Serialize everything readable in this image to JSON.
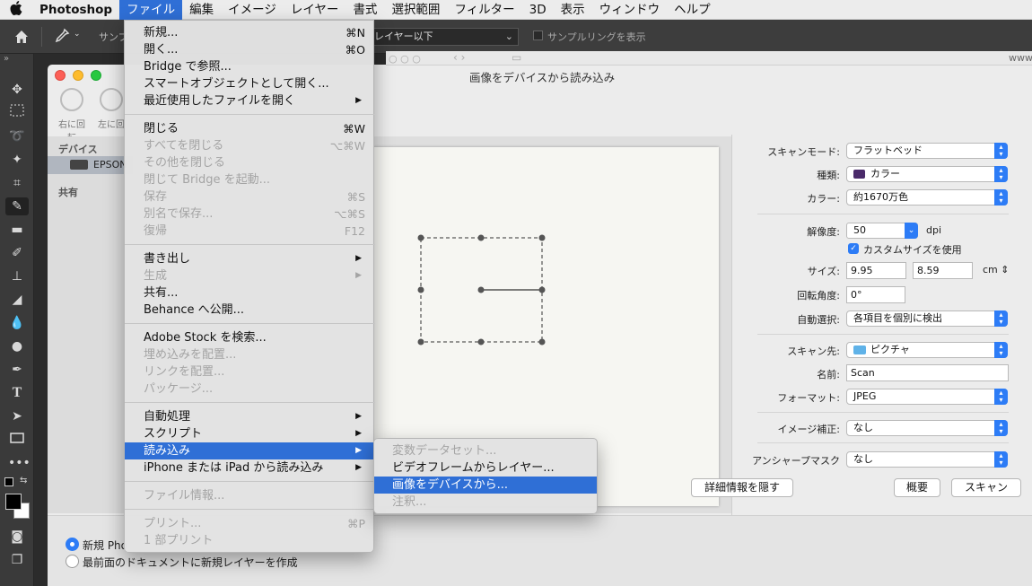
{
  "menubar": {
    "apple": "",
    "app_name": "Photoshop",
    "items": [
      "ファイル",
      "編集",
      "イメージ",
      "レイヤー",
      "書式",
      "選択範囲",
      "フィルター",
      "3D",
      "表示",
      "ウィンドウ",
      "ヘルプ"
    ]
  },
  "optionsbar": {
    "sample_label": "サンプ",
    "sample_select": "レイヤー以下",
    "checkbox_label": "サンプルリングを表示"
  },
  "file_menu": {
    "groups": [
      [
        {
          "label": "新規...",
          "shortcut": "⌘N",
          "disabled": false
        },
        {
          "label": "開く...",
          "shortcut": "⌘O",
          "disabled": false
        },
        {
          "label": "Bridge で参照...",
          "shortcut": "",
          "disabled": false
        },
        {
          "label": "スマートオブジェクトとして開く...",
          "shortcut": "",
          "disabled": false
        },
        {
          "label": "最近使用したファイルを開く",
          "shortcut": "",
          "submenu": true,
          "disabled": false
        }
      ],
      [
        {
          "label": "閉じる",
          "shortcut": "⌘W",
          "disabled": false
        },
        {
          "label": "すべてを閉じる",
          "shortcut": "⌥⌘W",
          "disabled": true
        },
        {
          "label": "その他を閉じる",
          "shortcut": "",
          "disabled": true
        },
        {
          "label": "閉じて Bridge を起動...",
          "shortcut": "",
          "disabled": true
        },
        {
          "label": "保存",
          "shortcut": "⌘S",
          "disabled": true
        },
        {
          "label": "別名で保存...",
          "shortcut": "⌥⌘S",
          "disabled": true
        },
        {
          "label": "復帰",
          "shortcut": "F12",
          "disabled": true
        }
      ],
      [
        {
          "label": "書き出し",
          "shortcut": "",
          "submenu": true,
          "disabled": false
        },
        {
          "label": "生成",
          "shortcut": "",
          "submenu": true,
          "disabled": true
        },
        {
          "label": "共有...",
          "shortcut": "",
          "disabled": false
        },
        {
          "label": "Behance へ公開...",
          "shortcut": "",
          "disabled": false
        }
      ],
      [
        {
          "label": "Adobe Stock を検索...",
          "shortcut": "",
          "disabled": false
        },
        {
          "label": "埋め込みを配置...",
          "shortcut": "",
          "disabled": true
        },
        {
          "label": "リンクを配置...",
          "shortcut": "",
          "disabled": true
        },
        {
          "label": "パッケージ...",
          "shortcut": "",
          "disabled": true
        }
      ],
      [
        {
          "label": "自動処理",
          "shortcut": "",
          "submenu": true,
          "disabled": false
        },
        {
          "label": "スクリプト",
          "shortcut": "",
          "submenu": true,
          "disabled": false
        },
        {
          "label": "読み込み",
          "shortcut": "",
          "submenu": true,
          "disabled": false,
          "highlighted": true
        },
        {
          "label": "iPhone または iPad から読み込み",
          "shortcut": "",
          "submenu": true,
          "disabled": false
        }
      ],
      [
        {
          "label": "ファイル情報...",
          "shortcut": "",
          "disabled": true
        }
      ],
      [
        {
          "label": "プリント...",
          "shortcut": "⌘P",
          "disabled": true
        },
        {
          "label": "1 部プリント",
          "shortcut": "",
          "disabled": true
        }
      ]
    ]
  },
  "import_submenu": [
    {
      "label": "変数データセット...",
      "disabled": true
    },
    {
      "label": "ビデオフレームからレイヤー...",
      "disabled": false
    },
    {
      "label": "画像をデバイスから...",
      "disabled": false,
      "highlighted": true
    },
    {
      "label": "注釈...",
      "disabled": true
    }
  ],
  "scan_window": {
    "title": "画像をデバイスから読み込み",
    "rotate_right": "右に回転",
    "rotate_left": "左に回",
    "sidebar": {
      "devices_header": "デバイス",
      "device_name": "EPSON",
      "shared_header": "共有"
    },
    "url_hint": "www",
    "settings": {
      "scan_mode_label": "スキャンモード:",
      "scan_mode": "フラットベッド",
      "kind_label": "種類:",
      "kind": "カラー",
      "color_label": "カラー:",
      "color": "約1670万色",
      "resolution_label": "解像度:",
      "resolution": "50",
      "resolution_unit": "dpi",
      "custom_size_label": "カスタムサイズを使用",
      "size_label": "サイズ:",
      "size_w": "9.95",
      "size_h": "8.59",
      "size_unit": "cm",
      "rotation_label": "回転角度:",
      "rotation": "0°",
      "auto_select_label": "自動選択:",
      "auto_select": "各項目を個別に検出",
      "scan_to_label": "スキャン先:",
      "scan_to": "ピクチャ",
      "name_label": "名前:",
      "name": "Scan",
      "format_label": "フォーマット:",
      "format": "JPEG",
      "image_correction_label": "イメージ補正:",
      "image_correction": "なし",
      "unsharp_label": "アンシャープマスク",
      "unsharp": "なし"
    },
    "buttons": {
      "hide_details": "詳細情報を隠す",
      "overview": "概要",
      "scan": "スキャン"
    },
    "bottom": {
      "radio1": "新規 Pho",
      "radio2": "最前面のドキュメントに新規レイヤーを作成"
    }
  },
  "colors": {
    "accent": "#2f6fd6",
    "popup_stepper": "#2d7cf6",
    "ps_dark": "#3a3a3a"
  }
}
